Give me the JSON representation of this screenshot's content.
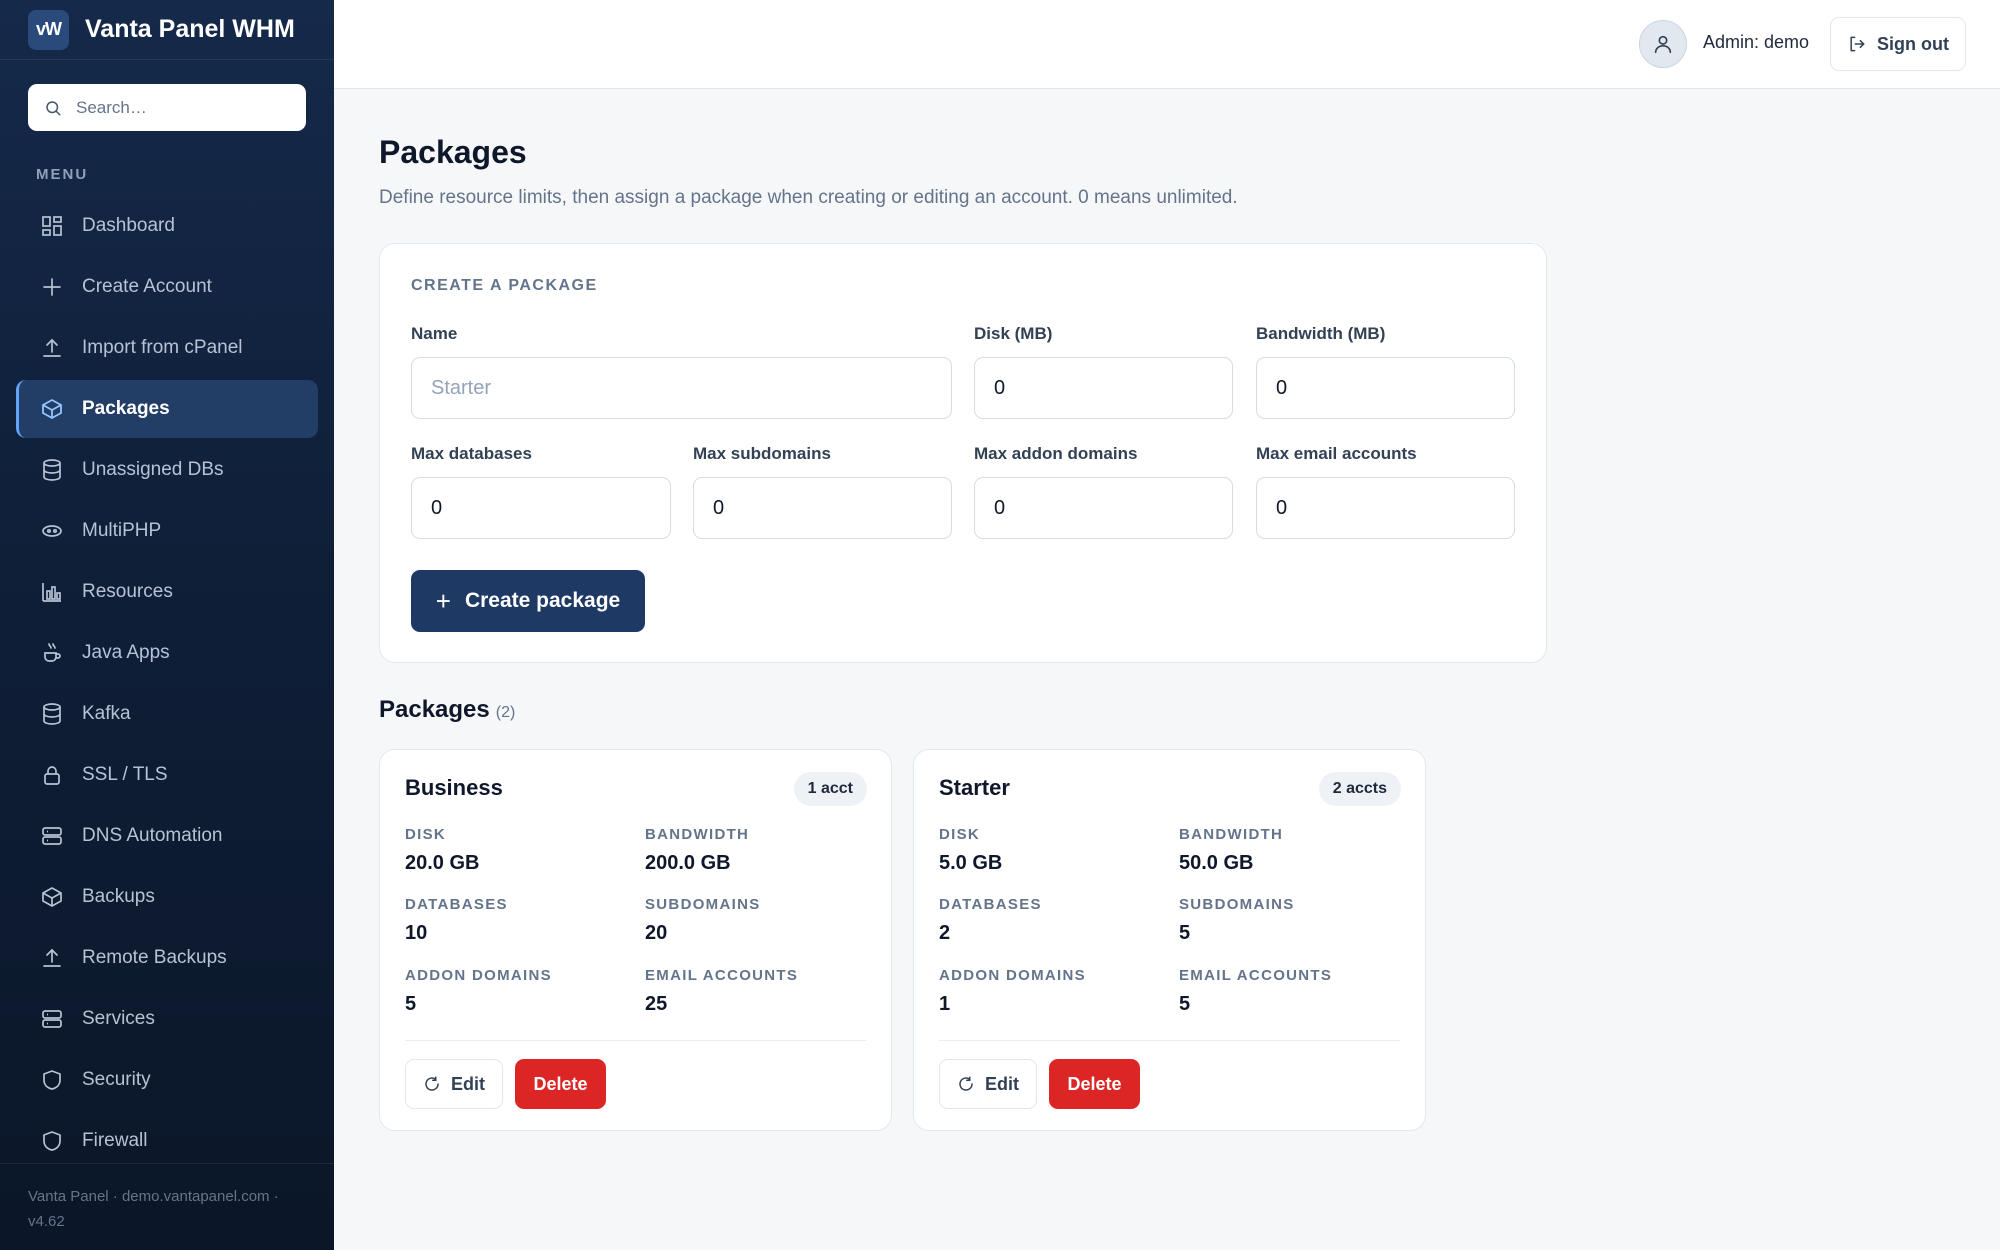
{
  "app": {
    "logo_text": "vW",
    "name": "Vanta Panel WHM"
  },
  "search": {
    "placeholder": "Search…"
  },
  "sidebar": {
    "menu_label": "MENU",
    "items": [
      {
        "label": "Dashboard",
        "icon": "dashboard-icon"
      },
      {
        "label": "Create Account",
        "icon": "plus-icon"
      },
      {
        "label": "Import from cPanel",
        "icon": "upload-icon"
      },
      {
        "label": "Packages",
        "icon": "package-icon",
        "active": true
      },
      {
        "label": "Unassigned DBs",
        "icon": "database-icon"
      },
      {
        "label": "MultiPHP",
        "icon": "php-icon"
      },
      {
        "label": "Resources",
        "icon": "bar-chart-icon"
      },
      {
        "label": "Java Apps",
        "icon": "coffee-icon"
      },
      {
        "label": "Kafka",
        "icon": "database-icon"
      },
      {
        "label": "SSL / TLS",
        "icon": "lock-icon"
      },
      {
        "label": "DNS Automation",
        "icon": "server-icon"
      },
      {
        "label": "Backups",
        "icon": "box-icon"
      },
      {
        "label": "Remote Backups",
        "icon": "upload-icon"
      },
      {
        "label": "Services",
        "icon": "server-icon"
      },
      {
        "label": "Security",
        "icon": "shield-icon"
      },
      {
        "label": "Firewall",
        "icon": "shield-icon"
      }
    ],
    "footer": "Vanta Panel · demo.vantapanel.com · v4.62"
  },
  "header": {
    "admin_label": "Admin: demo",
    "signout_label": "Sign out"
  },
  "page": {
    "title": "Packages",
    "description": "Define resource limits, then assign a package when creating or editing an account. 0 means unlimited."
  },
  "create_form": {
    "heading": "CREATE A PACKAGE",
    "name": {
      "label": "Name",
      "placeholder": "Starter",
      "value": ""
    },
    "disk": {
      "label": "Disk (MB)",
      "value": "0"
    },
    "bandwidth": {
      "label": "Bandwidth (MB)",
      "value": "0"
    },
    "max_databases": {
      "label": "Max databases",
      "value": "0"
    },
    "max_subdomains": {
      "label": "Max subdomains",
      "value": "0"
    },
    "max_addon_domains": {
      "label": "Max addon domains",
      "value": "0"
    },
    "max_email_accounts": {
      "label": "Max email accounts",
      "value": "0"
    },
    "submit_label": "Create package"
  },
  "packages_section": {
    "title": "Packages",
    "count": "(2)"
  },
  "stat_labels": {
    "disk": "DISK",
    "bandwidth": "BANDWIDTH",
    "databases": "DATABASES",
    "subdomains": "SUBDOMAINS",
    "addon_domains": "ADDON DOMAINS",
    "email_accounts": "EMAIL ACCOUNTS"
  },
  "packages": [
    {
      "name": "Business",
      "badge": "1 acct",
      "disk": "20.0 GB",
      "bandwidth": "200.0 GB",
      "databases": "10",
      "subdomains": "20",
      "addon_domains": "5",
      "email_accounts": "25",
      "edit_label": "Edit",
      "delete_label": "Delete"
    },
    {
      "name": "Starter",
      "badge": "2 accts",
      "disk": "5.0 GB",
      "bandwidth": "50.0 GB",
      "databases": "2",
      "subdomains": "5",
      "addon_domains": "1",
      "email_accounts": "5",
      "edit_label": "Edit",
      "delete_label": "Delete"
    }
  ],
  "colors": {
    "sidebar_bg": "#0f1f38",
    "accent": "#1e3a64",
    "danger": "#dc2626",
    "active_indicator": "#60a5fa"
  }
}
